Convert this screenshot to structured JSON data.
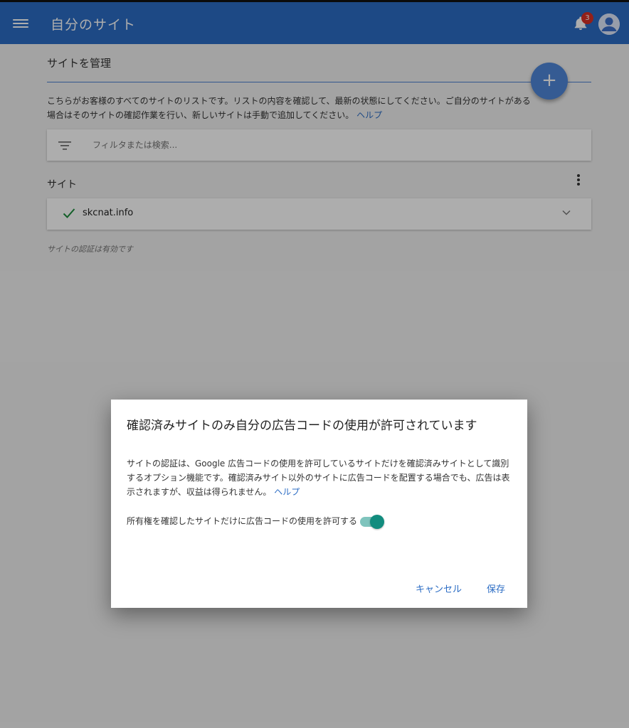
{
  "header": {
    "title": "自分のサイト",
    "notification_count": "3",
    "menu_icon": "hamburger-menu-icon",
    "bell_icon": "bell-icon",
    "avatar_icon": "account-avatar-icon"
  },
  "main": {
    "section_title": "サイトを管理",
    "add_button_label": "+",
    "description": "こちらがお客様のすべてのサイトのリストです。リストの内容を確認して、最新の状態にしてください。ご自分のサイトがある場合はそのサイトの確認作業を行い、新しいサイトは手動で追加してください。",
    "help_link": "ヘルプ",
    "filter": {
      "placeholder": "フィルタまたは検索...",
      "icon": "filter-icon"
    },
    "sites_label": "サイト",
    "sites": [
      {
        "name": "skcnat.info",
        "status_icon": "check-icon"
      }
    ],
    "note": "サイトの認証は有効です"
  },
  "dialog": {
    "title": "確認済みサイトのみ自分の広告コードの使用が許可されています",
    "body": "サイトの認証は、Google 広告コードの使用を許可しているサイトだけを確認済みサイトとして識別するオプション機能です。確認済みサイト以外のサイトに広告コードを配置する場合でも、広告は表示されますが、収益は得られません。",
    "help_link": "ヘルプ",
    "toggle_label": "所有権を確認したサイトだけに広告コードの使用を許可する",
    "toggle_on": true,
    "cancel_label": "キャンセル",
    "save_label": "保存"
  },
  "colors": {
    "header": "#2b6cc4",
    "accent": "#4f86d9",
    "check": "#1e8e3e",
    "toggle": "#128c7e"
  }
}
